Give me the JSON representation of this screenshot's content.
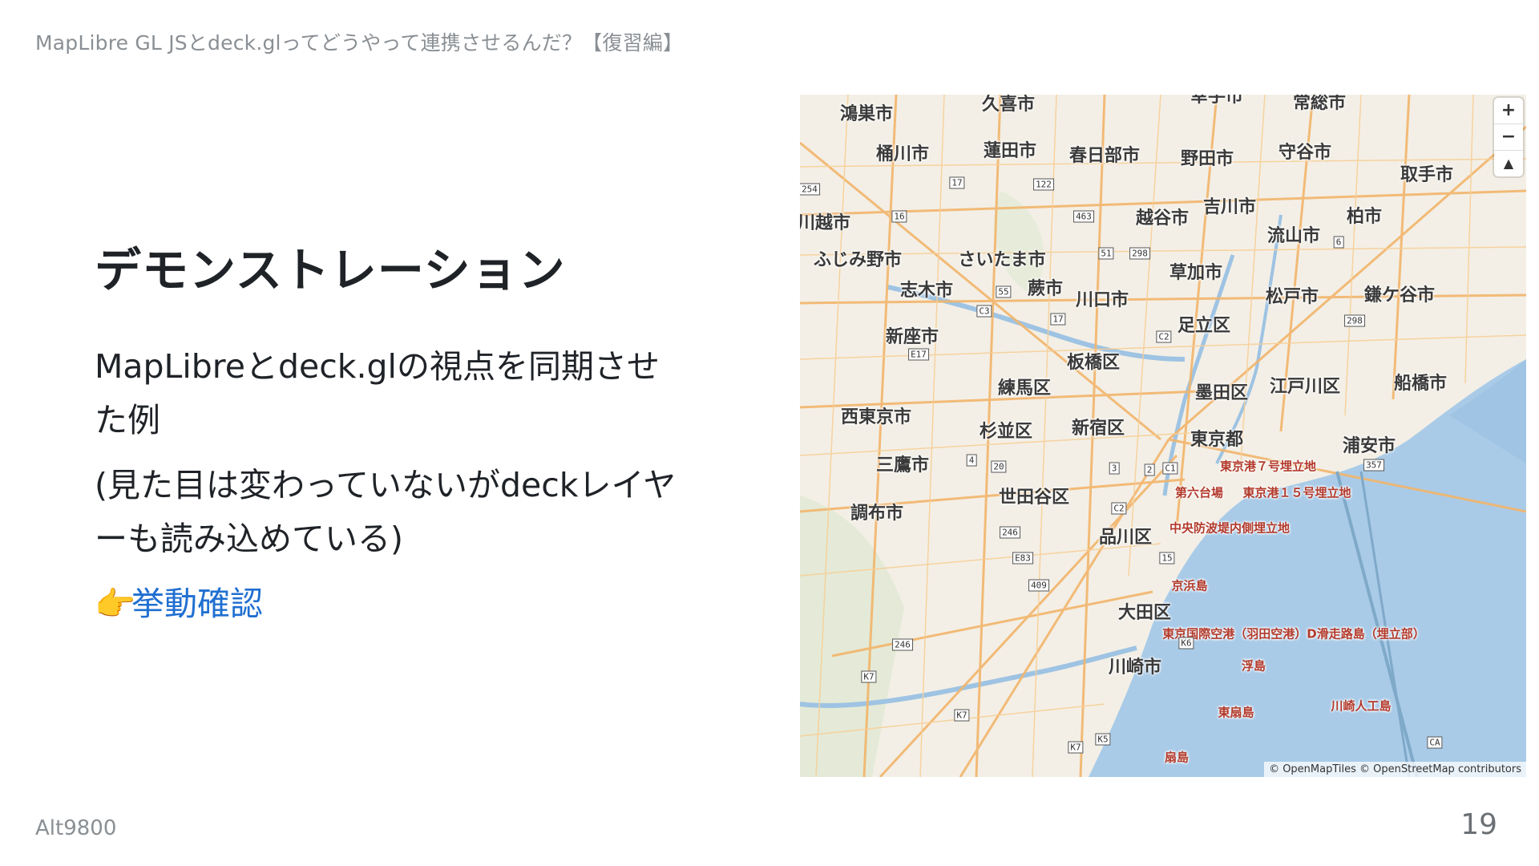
{
  "header": {
    "title": "MapLibre GL JSとdeck.glってどうやって連携させるんだ？【復習編】"
  },
  "slide": {
    "heading": "デモンストレーション",
    "paragraphs": [
      "MapLibreとdeck.glの視点を同期させた例",
      "(見た目は変わっていないがdeckレイヤーも読み込めている)"
    ],
    "link_emoji": "👉",
    "link_text": "挙動確認"
  },
  "footer": {
    "author": "Alt9800",
    "page": "19"
  },
  "map": {
    "controls": {
      "zoom_in": "+",
      "zoom_out": "−",
      "compass": "▲"
    },
    "attribution": "© OpenMapTiles © OpenStreetMap contributors",
    "labels": [
      "鴻巣市",
      "久喜市",
      "幸手市",
      "常総市",
      "桶川市",
      "蓮田市",
      "春日部市",
      "野田市",
      "守谷市",
      "取手市",
      "川越市",
      "越谷市",
      "吉川市",
      "柏市",
      "流山市",
      "ふじみ野市",
      "さいたま市",
      "草加市",
      "志木市",
      "蕨市",
      "川口市",
      "松戸市",
      "鎌ケ谷市",
      "新座市",
      "足立区",
      "板橋区",
      "練馬区",
      "墨田区",
      "江戸川区",
      "船橋市",
      "西東京市",
      "杉並区",
      "新宿区",
      "東京都",
      "浦安市",
      "三鷹市",
      "世田谷区",
      "調布市",
      "品川区",
      "大田区",
      "川崎市"
    ],
    "small_labels": [
      "東京港７号埋立地",
      "第六台場",
      "東京港１５号埋立地",
      "中央防波堤内側埋立地",
      "京浜島",
      "東京国際空港（羽田空港）D滑走路島（埋立部）",
      "浮島",
      "東扇島",
      "扇島",
      "川崎人工島"
    ],
    "roads": [
      "17",
      "122",
      "463",
      "16",
      "254",
      "51",
      "298",
      "C3",
      "55",
      "17",
      "E17",
      "C2",
      "6",
      "298",
      "4",
      "20",
      "3",
      "2",
      "C1",
      "357",
      "C2",
      "246",
      "E83",
      "409",
      "15",
      "246",
      "K7",
      "K6",
      "K7",
      "K5",
      "K7",
      "CA"
    ]
  }
}
